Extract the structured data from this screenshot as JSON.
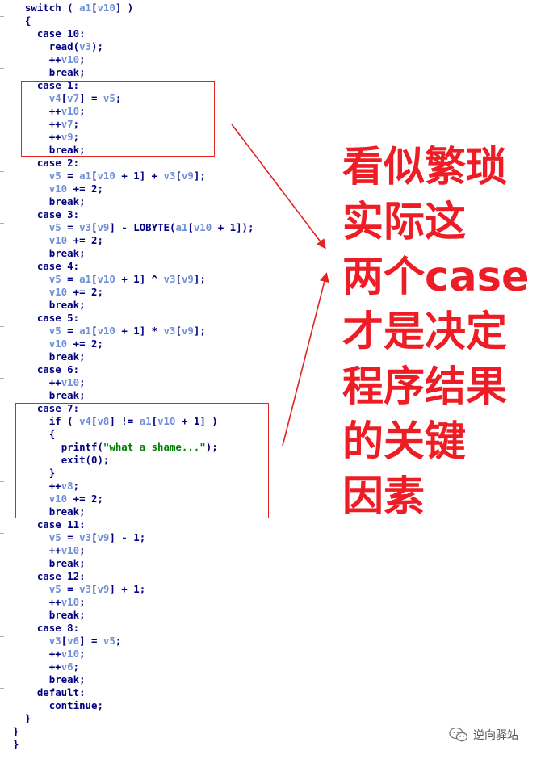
{
  "code_lines": [
    [
      {
        "t": "  ",
        "c": "punct"
      },
      {
        "t": "switch",
        "c": "kw"
      },
      {
        "t": " ( ",
        "c": "punct"
      },
      {
        "t": "a1",
        "c": "var"
      },
      {
        "t": "[",
        "c": "punct"
      },
      {
        "t": "v10",
        "c": "var"
      },
      {
        "t": "] )",
        "c": "punct"
      }
    ],
    [
      {
        "t": "  {",
        "c": "punct"
      }
    ],
    [
      {
        "t": "    ",
        "c": "punct"
      },
      {
        "t": "case",
        "c": "kw"
      },
      {
        "t": " 10:",
        "c": "num"
      }
    ],
    [
      {
        "t": "      ",
        "c": "punct"
      },
      {
        "t": "read(",
        "c": "kw"
      },
      {
        "t": "v3",
        "c": "var"
      },
      {
        "t": ");",
        "c": "punct"
      }
    ],
    [
      {
        "t": "      ++",
        "c": "punct"
      },
      {
        "t": "v10",
        "c": "var"
      },
      {
        "t": ";",
        "c": "punct"
      }
    ],
    [
      {
        "t": "      ",
        "c": "punct"
      },
      {
        "t": "break",
        "c": "kw"
      },
      {
        "t": ";",
        "c": "punct"
      }
    ],
    [
      {
        "t": "    ",
        "c": "punct"
      },
      {
        "t": "case",
        "c": "kw"
      },
      {
        "t": " 1:",
        "c": "num"
      }
    ],
    [
      {
        "t": "      ",
        "c": "punct"
      },
      {
        "t": "v4",
        "c": "var"
      },
      {
        "t": "[",
        "c": "punct"
      },
      {
        "t": "v7",
        "c": "var"
      },
      {
        "t": "] = ",
        "c": "punct"
      },
      {
        "t": "v5",
        "c": "var"
      },
      {
        "t": ";",
        "c": "punct"
      }
    ],
    [
      {
        "t": "      ++",
        "c": "punct"
      },
      {
        "t": "v10",
        "c": "var"
      },
      {
        "t": ";",
        "c": "punct"
      }
    ],
    [
      {
        "t": "      ++",
        "c": "punct"
      },
      {
        "t": "v7",
        "c": "var"
      },
      {
        "t": ";",
        "c": "punct"
      }
    ],
    [
      {
        "t": "      ++",
        "c": "punct"
      },
      {
        "t": "v9",
        "c": "var"
      },
      {
        "t": ";",
        "c": "punct"
      }
    ],
    [
      {
        "t": "      ",
        "c": "punct"
      },
      {
        "t": "break",
        "c": "kw"
      },
      {
        "t": ";",
        "c": "punct"
      }
    ],
    [
      {
        "t": "    ",
        "c": "punct"
      },
      {
        "t": "case",
        "c": "kw"
      },
      {
        "t": " 2:",
        "c": "num"
      }
    ],
    [
      {
        "t": "      ",
        "c": "punct"
      },
      {
        "t": "v5",
        "c": "var"
      },
      {
        "t": " = ",
        "c": "punct"
      },
      {
        "t": "a1",
        "c": "var"
      },
      {
        "t": "[",
        "c": "punct"
      },
      {
        "t": "v10",
        "c": "var"
      },
      {
        "t": " + 1] + ",
        "c": "punct"
      },
      {
        "t": "v3",
        "c": "var"
      },
      {
        "t": "[",
        "c": "punct"
      },
      {
        "t": "v9",
        "c": "var"
      },
      {
        "t": "];",
        "c": "punct"
      }
    ],
    [
      {
        "t": "      ",
        "c": "punct"
      },
      {
        "t": "v10",
        "c": "var"
      },
      {
        "t": " += 2;",
        "c": "punct"
      }
    ],
    [
      {
        "t": "      ",
        "c": "punct"
      },
      {
        "t": "break",
        "c": "kw"
      },
      {
        "t": ";",
        "c": "punct"
      }
    ],
    [
      {
        "t": "    ",
        "c": "punct"
      },
      {
        "t": "case",
        "c": "kw"
      },
      {
        "t": " 3:",
        "c": "num"
      }
    ],
    [
      {
        "t": "      ",
        "c": "punct"
      },
      {
        "t": "v5",
        "c": "var"
      },
      {
        "t": " = ",
        "c": "punct"
      },
      {
        "t": "v3",
        "c": "var"
      },
      {
        "t": "[",
        "c": "punct"
      },
      {
        "t": "v9",
        "c": "var"
      },
      {
        "t": "] - LOBYTE(",
        "c": "punct"
      },
      {
        "t": "a1",
        "c": "var"
      },
      {
        "t": "[",
        "c": "punct"
      },
      {
        "t": "v10",
        "c": "var"
      },
      {
        "t": " + 1]);",
        "c": "punct"
      }
    ],
    [
      {
        "t": "      ",
        "c": "punct"
      },
      {
        "t": "v10",
        "c": "var"
      },
      {
        "t": " += 2;",
        "c": "punct"
      }
    ],
    [
      {
        "t": "      ",
        "c": "punct"
      },
      {
        "t": "break",
        "c": "kw"
      },
      {
        "t": ";",
        "c": "punct"
      }
    ],
    [
      {
        "t": "    ",
        "c": "punct"
      },
      {
        "t": "case",
        "c": "kw"
      },
      {
        "t": " 4:",
        "c": "num"
      }
    ],
    [
      {
        "t": "      ",
        "c": "punct"
      },
      {
        "t": "v5",
        "c": "var"
      },
      {
        "t": " = ",
        "c": "punct"
      },
      {
        "t": "a1",
        "c": "var"
      },
      {
        "t": "[",
        "c": "punct"
      },
      {
        "t": "v10",
        "c": "var"
      },
      {
        "t": " + 1] ^ ",
        "c": "punct"
      },
      {
        "t": "v3",
        "c": "var"
      },
      {
        "t": "[",
        "c": "punct"
      },
      {
        "t": "v9",
        "c": "var"
      },
      {
        "t": "];",
        "c": "punct"
      }
    ],
    [
      {
        "t": "      ",
        "c": "punct"
      },
      {
        "t": "v10",
        "c": "var"
      },
      {
        "t": " += 2;",
        "c": "punct"
      }
    ],
    [
      {
        "t": "      ",
        "c": "punct"
      },
      {
        "t": "break",
        "c": "kw"
      },
      {
        "t": ";",
        "c": "punct"
      }
    ],
    [
      {
        "t": "    ",
        "c": "punct"
      },
      {
        "t": "case",
        "c": "kw"
      },
      {
        "t": " 5:",
        "c": "num"
      }
    ],
    [
      {
        "t": "      ",
        "c": "punct"
      },
      {
        "t": "v5",
        "c": "var"
      },
      {
        "t": " = ",
        "c": "punct"
      },
      {
        "t": "a1",
        "c": "var"
      },
      {
        "t": "[",
        "c": "punct"
      },
      {
        "t": "v10",
        "c": "var"
      },
      {
        "t": " + 1] * ",
        "c": "punct"
      },
      {
        "t": "v3",
        "c": "var"
      },
      {
        "t": "[",
        "c": "punct"
      },
      {
        "t": "v9",
        "c": "var"
      },
      {
        "t": "];",
        "c": "punct"
      }
    ],
    [
      {
        "t": "      ",
        "c": "punct"
      },
      {
        "t": "v10",
        "c": "var"
      },
      {
        "t": " += 2;",
        "c": "punct"
      }
    ],
    [
      {
        "t": "      ",
        "c": "punct"
      },
      {
        "t": "break",
        "c": "kw"
      },
      {
        "t": ";",
        "c": "punct"
      }
    ],
    [
      {
        "t": "    ",
        "c": "punct"
      },
      {
        "t": "case",
        "c": "kw"
      },
      {
        "t": " 6:",
        "c": "num"
      }
    ],
    [
      {
        "t": "      ++",
        "c": "punct"
      },
      {
        "t": "v10",
        "c": "var"
      },
      {
        "t": ";",
        "c": "punct"
      }
    ],
    [
      {
        "t": "      ",
        "c": "punct"
      },
      {
        "t": "break",
        "c": "kw"
      },
      {
        "t": ";",
        "c": "punct"
      }
    ],
    [
      {
        "t": "    ",
        "c": "punct"
      },
      {
        "t": "case",
        "c": "kw"
      },
      {
        "t": " 7:",
        "c": "num"
      }
    ],
    [
      {
        "t": "      ",
        "c": "punct"
      },
      {
        "t": "if",
        "c": "kw"
      },
      {
        "t": " ( ",
        "c": "punct"
      },
      {
        "t": "v4",
        "c": "var"
      },
      {
        "t": "[",
        "c": "punct"
      },
      {
        "t": "v8",
        "c": "var"
      },
      {
        "t": "] != ",
        "c": "punct"
      },
      {
        "t": "a1",
        "c": "var"
      },
      {
        "t": "[",
        "c": "punct"
      },
      {
        "t": "v10",
        "c": "var"
      },
      {
        "t": " + 1] )",
        "c": "punct"
      }
    ],
    [
      {
        "t": "      {",
        "c": "punct"
      }
    ],
    [
      {
        "t": "        ",
        "c": "punct"
      },
      {
        "t": "printf(",
        "c": "kw"
      },
      {
        "t": "\"what a shame...\"",
        "c": "str"
      },
      {
        "t": ");",
        "c": "punct"
      }
    ],
    [
      {
        "t": "        ",
        "c": "punct"
      },
      {
        "t": "exit(",
        "c": "kw"
      },
      {
        "t": "0",
        "c": "num"
      },
      {
        "t": ");",
        "c": "punct"
      }
    ],
    [
      {
        "t": "      }",
        "c": "punct"
      }
    ],
    [
      {
        "t": "      ++",
        "c": "punct"
      },
      {
        "t": "v8",
        "c": "var"
      },
      {
        "t": ";",
        "c": "punct"
      }
    ],
    [
      {
        "t": "      ",
        "c": "punct"
      },
      {
        "t": "v10",
        "c": "var"
      },
      {
        "t": " += 2;",
        "c": "punct"
      }
    ],
    [
      {
        "t": "      ",
        "c": "punct"
      },
      {
        "t": "break",
        "c": "kw"
      },
      {
        "t": ";",
        "c": "punct"
      }
    ],
    [
      {
        "t": "    ",
        "c": "punct"
      },
      {
        "t": "case",
        "c": "kw"
      },
      {
        "t": " 11:",
        "c": "num"
      }
    ],
    [
      {
        "t": "      ",
        "c": "punct"
      },
      {
        "t": "v5",
        "c": "var"
      },
      {
        "t": " = ",
        "c": "punct"
      },
      {
        "t": "v3",
        "c": "var"
      },
      {
        "t": "[",
        "c": "punct"
      },
      {
        "t": "v9",
        "c": "var"
      },
      {
        "t": "] - 1;",
        "c": "punct"
      }
    ],
    [
      {
        "t": "      ++",
        "c": "punct"
      },
      {
        "t": "v10",
        "c": "var"
      },
      {
        "t": ";",
        "c": "punct"
      }
    ],
    [
      {
        "t": "      ",
        "c": "punct"
      },
      {
        "t": "break",
        "c": "kw"
      },
      {
        "t": ";",
        "c": "punct"
      }
    ],
    [
      {
        "t": "    ",
        "c": "punct"
      },
      {
        "t": "case",
        "c": "kw"
      },
      {
        "t": " 12:",
        "c": "num"
      }
    ],
    [
      {
        "t": "      ",
        "c": "punct"
      },
      {
        "t": "v5",
        "c": "var"
      },
      {
        "t": " = ",
        "c": "punct"
      },
      {
        "t": "v3",
        "c": "var"
      },
      {
        "t": "[",
        "c": "punct"
      },
      {
        "t": "v9",
        "c": "var"
      },
      {
        "t": "] + 1;",
        "c": "punct"
      }
    ],
    [
      {
        "t": "      ++",
        "c": "punct"
      },
      {
        "t": "v10",
        "c": "var"
      },
      {
        "t": ";",
        "c": "punct"
      }
    ],
    [
      {
        "t": "      ",
        "c": "punct"
      },
      {
        "t": "break",
        "c": "kw"
      },
      {
        "t": ";",
        "c": "punct"
      }
    ],
    [
      {
        "t": "    ",
        "c": "punct"
      },
      {
        "t": "case",
        "c": "kw"
      },
      {
        "t": " 8:",
        "c": "num"
      }
    ],
    [
      {
        "t": "      ",
        "c": "punct"
      },
      {
        "t": "v3",
        "c": "var"
      },
      {
        "t": "[",
        "c": "punct"
      },
      {
        "t": "v6",
        "c": "var"
      },
      {
        "t": "] = ",
        "c": "punct"
      },
      {
        "t": "v5",
        "c": "var"
      },
      {
        "t": ";",
        "c": "punct"
      }
    ],
    [
      {
        "t": "      ++",
        "c": "punct"
      },
      {
        "t": "v10",
        "c": "var"
      },
      {
        "t": ";",
        "c": "punct"
      }
    ],
    [
      {
        "t": "      ++",
        "c": "punct"
      },
      {
        "t": "v6",
        "c": "var"
      },
      {
        "t": ";",
        "c": "punct"
      }
    ],
    [
      {
        "t": "      ",
        "c": "punct"
      },
      {
        "t": "break",
        "c": "kw"
      },
      {
        "t": ";",
        "c": "punct"
      }
    ],
    [
      {
        "t": "    ",
        "c": "punct"
      },
      {
        "t": "default",
        "c": "kw"
      },
      {
        "t": ":",
        "c": "punct"
      }
    ],
    [
      {
        "t": "      ",
        "c": "punct"
      },
      {
        "t": "continue",
        "c": "kw"
      },
      {
        "t": ";",
        "c": "punct"
      }
    ],
    [
      {
        "t": "  }",
        "c": "punct"
      }
    ],
    [
      {
        "t": "}",
        "c": "punct"
      }
    ],
    [
      {
        "t": "}",
        "c": "punct"
      }
    ]
  ],
  "annotation": {
    "lines": [
      "看似繁琐",
      "实际这",
      "两个case",
      "才是决定",
      "程序结果",
      "的关键",
      "因素"
    ],
    "color": "#ee1c25"
  },
  "highlight_color": "#e32222",
  "watermark": {
    "text": "逆向驿站",
    "icon": "wechat-icon"
  },
  "colors": {
    "keyword": "#000080",
    "variable": "#6f8fd8",
    "string": "#008000"
  }
}
